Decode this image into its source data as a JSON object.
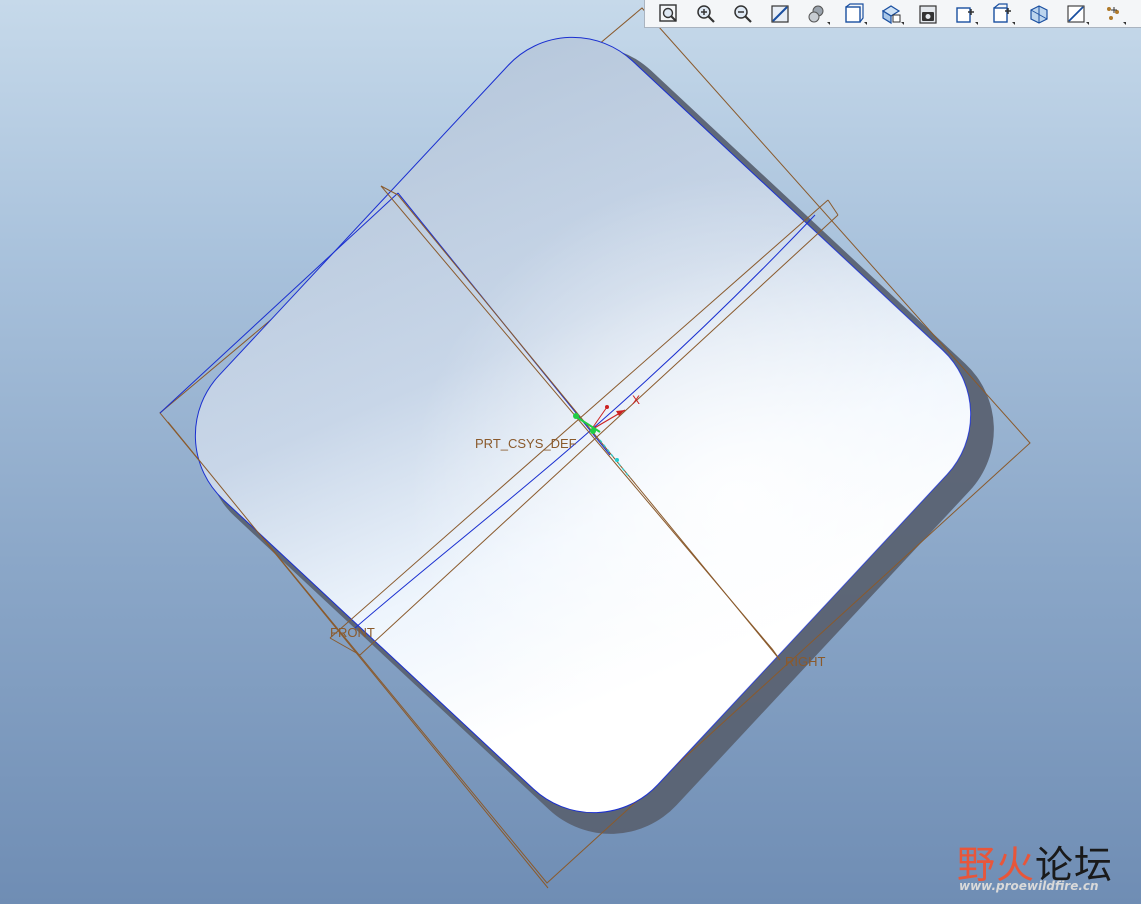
{
  "viewport": {
    "csys_label": "PRT_CSYS_DEF",
    "axis_x_label": "X",
    "datum_planes": {
      "front": "FRONT",
      "right": "RIGHT"
    },
    "colors": {
      "datum_plane": "#8a5a2c",
      "model_edge": "#1a2fd0",
      "background_top": "#c6d9ea",
      "background_bottom": "#6f8db4"
    }
  },
  "toolbar": {
    "buttons": [
      {
        "icon": "refit-icon"
      },
      {
        "icon": "zoom-in-icon"
      },
      {
        "icon": "zoom-out-icon"
      },
      {
        "icon": "repaint-icon"
      },
      {
        "icon": "display-style-icon",
        "dropdown": true
      },
      {
        "icon": "saved-views-icon",
        "dropdown": true
      },
      {
        "icon": "view-manager-icon",
        "dropdown": true
      },
      {
        "icon": "screenshot-icon"
      },
      {
        "icon": "datum-plane-display-icon",
        "dropdown": true
      },
      {
        "icon": "datum-axis-display-icon",
        "dropdown": true
      },
      {
        "icon": "spin-center-icon"
      },
      {
        "icon": "annotation-display-icon",
        "dropdown": true
      },
      {
        "icon": "datum-point-display-icon",
        "dropdown": true
      }
    ]
  },
  "watermark": {
    "title_part1": "野火",
    "title_part2": "论坛",
    "url": "www.proewildfire.cn"
  }
}
